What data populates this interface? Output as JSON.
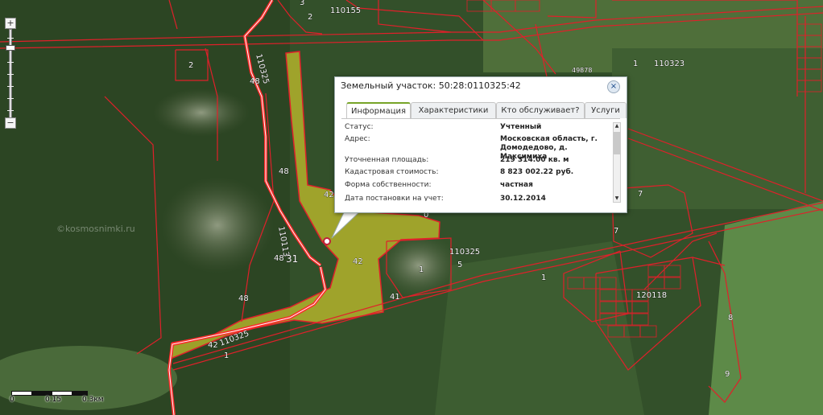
{
  "map": {
    "labels": {
      "n3": "3",
      "n110155": "110155",
      "n2a": "2",
      "n2b": "2",
      "n110325_road": "110325",
      "n48a": "48",
      "n48b": "48",
      "n48c": "48",
      "n48d": "48",
      "n42a": "42",
      "n42b": "42",
      "n42c": "42",
      "n110113": "110113",
      "n31": "31",
      "n110325_bottom": "110325",
      "n1a": "1",
      "n1b": "1",
      "n1c": "1",
      "n1d": "1",
      "n41": "41",
      "n0": "0",
      "n110325_right": "110325",
      "n5": "5",
      "n49878": "49878",
      "n110323": "110323",
      "n7a": "7",
      "n7b": "7",
      "n120118": "120118",
      "n8": "8",
      "n9": "9",
      "watermark": "©kosmosnimki.ru"
    }
  },
  "zoom": {
    "plus": "+",
    "minus": "−"
  },
  "scale": {
    "l0": "0",
    "l1": "0.15",
    "l2": "0.3км"
  },
  "popup": {
    "title": "Земельный участок: 50:28:0110325:42",
    "close": "×",
    "tabs": [
      "Информация",
      "Характеристики",
      "Кто обслуживает?",
      "Услуги"
    ],
    "rows": [
      {
        "k": "Статус:",
        "v": "Учтенный"
      },
      {
        "k": "Адрес:",
        "v": "Московская область, г. Домодедово, д. Максимиха"
      },
      {
        "k": "Уточненная площадь:",
        "v": "219 314.00 кв. м"
      },
      {
        "k": "Кадастровая стоимость:",
        "v": "8 823 002.22 руб."
      },
      {
        "k": "Форма собственности:",
        "v": "частная"
      },
      {
        "k": "Дата постановки на учет:",
        "v": "30.12.2014"
      }
    ]
  },
  "colors": {
    "parcel_border": "#e0202a",
    "highlight_fill": "#c9c42c",
    "road": "#ff2a2a",
    "tab_accent": "#77a428"
  }
}
